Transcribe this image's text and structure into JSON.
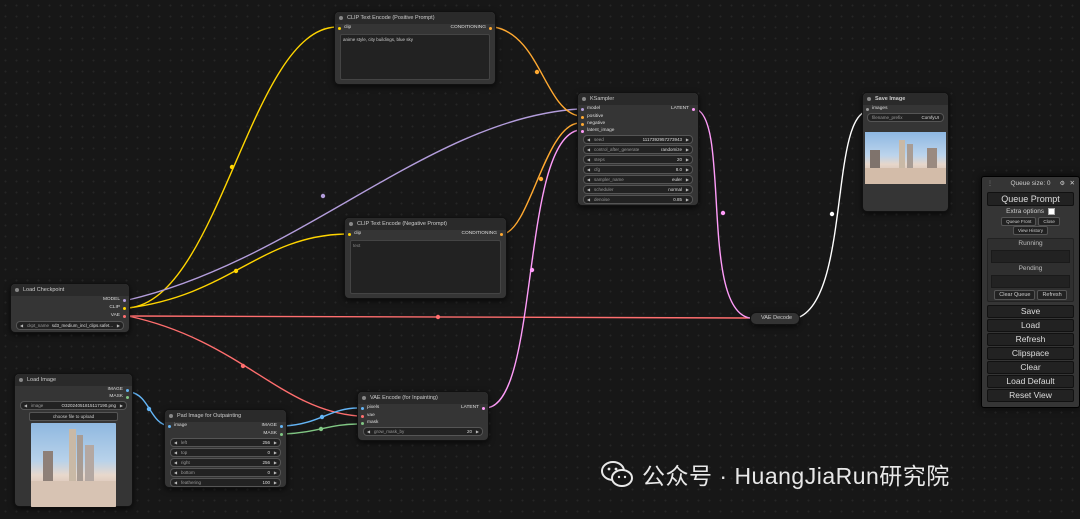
{
  "nodes": {
    "positive": {
      "title": "CLIP Text Encode (Positive Prompt)",
      "in_clip": "clip",
      "out_cond": "CONDITIONING",
      "text": "anime style, city buildings, blue sky"
    },
    "negative": {
      "title": "CLIP Text Encode (Negative Prompt)",
      "in_clip": "clip",
      "out_cond": "CONDITIONING",
      "text": "text"
    },
    "ksampler": {
      "title": "KSampler",
      "in_model": "model",
      "in_positive": "positive",
      "in_negative": "negative",
      "in_latent": "latent_image",
      "out_latent": "LATENT",
      "widgets": [
        {
          "k": "seed",
          "v": "1117392957273943"
        },
        {
          "k": "control_after_generate",
          "v": "randomize"
        },
        {
          "k": "steps",
          "v": "20"
        },
        {
          "k": "cfg",
          "v": "8.0"
        },
        {
          "k": "sampler_name",
          "v": "euler"
        },
        {
          "k": "scheduler",
          "v": "normal"
        },
        {
          "k": "denoise",
          "v": "0.85"
        }
      ]
    },
    "checkpoint": {
      "title": "Load Checkpoint",
      "out_model": "MODEL",
      "out_clip": "CLIP",
      "out_vae": "VAE",
      "ckpt_key": "ckpt_name",
      "ckpt_val": "sd3_medium_incl_clips.safet..."
    },
    "loadimage": {
      "title": "Load Image",
      "out_image": "IMAGE",
      "out_mask": "MASK",
      "image_key": "image",
      "image_val": "O32024051815117190.png",
      "upload": "choose file to upload"
    },
    "pad": {
      "title": "Pad Image for Outpainting",
      "in_image": "image",
      "out_image": "IMAGE",
      "out_mask": "MASK",
      "widgets": [
        {
          "k": "left",
          "v": "256"
        },
        {
          "k": "top",
          "v": "0"
        },
        {
          "k": "right",
          "v": "256"
        },
        {
          "k": "bottom",
          "v": "0"
        },
        {
          "k": "feathering",
          "v": "100"
        }
      ]
    },
    "vaeinpaint": {
      "title": "VAE Encode (for Inpainting)",
      "in_pixels": "pixels",
      "in_vae": "vae",
      "in_mask": "mask",
      "out_latent": "LATENT",
      "grow_key": "grow_mask_by",
      "grow_val": "20"
    },
    "vaedecode": {
      "title": "VAE Decode"
    },
    "saveimage": {
      "title": "Save Image",
      "in_images": "images",
      "prefix_key": "filename_prefix",
      "prefix_val": "ComfyUI"
    }
  },
  "queue": {
    "title": "Queue size: 0",
    "queue_prompt": "Queue Prompt",
    "extra_options": "Extra options",
    "queue_front": "Queue Front",
    "close": "Close",
    "view_history": "View History",
    "running": "Running",
    "pending": "Pending",
    "clear_queue": "Clear Queue",
    "refresh_small": "Refresh",
    "save": "Save",
    "load": "Load",
    "refresh": "Refresh",
    "clipspace": "Clipspace",
    "clear": "Clear",
    "load_default": "Load Default",
    "reset_view": "Reset View"
  },
  "watermark": "公众号 · HuangJiaRun研究院",
  "colors": {
    "model": "#b39ddb",
    "clip": "#ffd500",
    "vae": "#ff6e6e",
    "conditioning": "#ffa931",
    "latent": "#ff9cf9",
    "image": "#64b5f6",
    "mask": "#81c784",
    "output_image": "#ffffff"
  }
}
